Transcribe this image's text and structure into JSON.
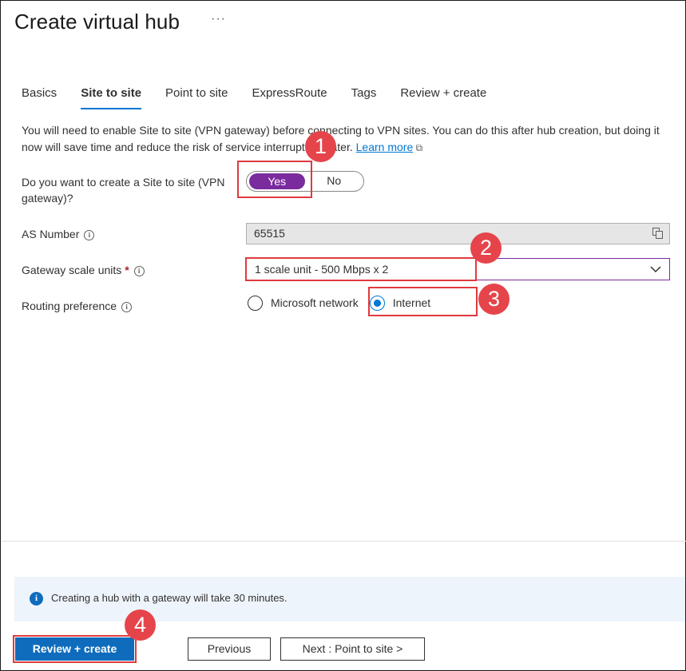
{
  "header": {
    "title": "Create virtual hub",
    "more": "···"
  },
  "tabs": [
    {
      "label": "Basics",
      "active": false
    },
    {
      "label": "Site to site",
      "active": true
    },
    {
      "label": "Point to site",
      "active": false
    },
    {
      "label": "ExpressRoute",
      "active": false
    },
    {
      "label": "Tags",
      "active": false
    },
    {
      "label": "Review + create",
      "active": false
    }
  ],
  "info": {
    "text": "You will need to enable Site to site (VPN gateway) before connecting to VPN sites. You can do this after hub creation, but doing it now will save time and reduce the risk of service interruptions later. ",
    "link": "Learn more"
  },
  "form": {
    "vpn_question": "Do you want to create a Site to site (VPN gateway)?",
    "toggle_yes": "Yes",
    "toggle_no": "No",
    "toggle_selected": "Yes",
    "as_label": "AS Number",
    "as_value": "65515",
    "scale_label": "Gateway scale units",
    "scale_required": "*",
    "scale_value": "1 scale unit - 500 Mbps x 2",
    "routing_label": "Routing preference",
    "routing_options": [
      "Microsoft network",
      "Internet"
    ],
    "routing_selected": "Internet"
  },
  "banner": {
    "text": "Creating a hub with a gateway will take 30 minutes."
  },
  "footer": {
    "review_create": "Review + create",
    "previous": "Previous",
    "next": "Next : Point to site >"
  },
  "callouts": [
    "1",
    "2",
    "3",
    "4"
  ],
  "colors": {
    "accent": "#0078d4",
    "toggle_on": "#7a2b9e",
    "callout": "#e5454a",
    "primary_button": "#0f6cbd"
  }
}
